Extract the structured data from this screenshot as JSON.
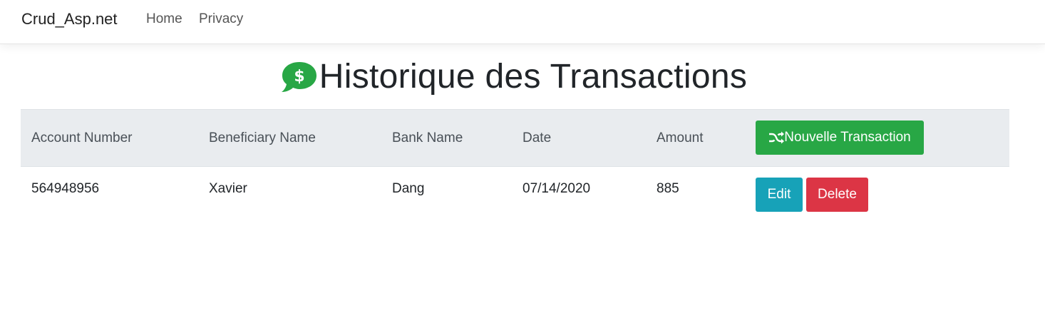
{
  "navbar": {
    "brand": "Crud_Asp.net",
    "links": [
      "Home",
      "Privacy"
    ]
  },
  "page": {
    "title": "Historique des Transactions",
    "title_icon": "comment-dollar-icon"
  },
  "table": {
    "headers": [
      "Account Number",
      "Beneficiary Name",
      "Bank Name",
      "Date",
      "Amount"
    ],
    "new_button": "Nouvelle Transaction",
    "new_button_icon": "shuffle-icon",
    "rows": [
      {
        "account_number": "564948956",
        "beneficiary_name": "Xavier",
        "bank_name": "Dang",
        "date": "07/14/2020",
        "amount": "885",
        "edit_label": "Edit",
        "delete_label": "Delete"
      }
    ]
  },
  "colors": {
    "success": "#28a745",
    "info": "#17a2b8",
    "danger": "#dc3545",
    "header_bg": "#e9ecef"
  }
}
